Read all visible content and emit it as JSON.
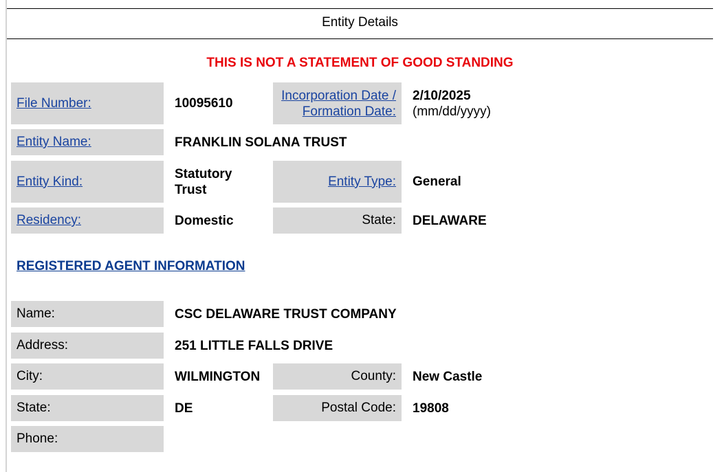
{
  "header": {
    "title": "Entity Details"
  },
  "warning": "THIS IS NOT A STATEMENT OF GOOD STANDING",
  "entity": {
    "file_number_label": "File Number:",
    "file_number": "10095610",
    "incorporation_label_1": "Incorporation Date /",
    "incorporation_label_2": "Formation Date:",
    "incorporation_date": "2/10/2025",
    "incorporation_format": "(mm/dd/yyyy)",
    "entity_name_label": "Entity Name:",
    "entity_name": "FRANKLIN SOLANA TRUST",
    "entity_kind_label": "Entity Kind:",
    "entity_kind_1": "Statutory",
    "entity_kind_2": "Trust",
    "entity_type_label": "Entity Type:",
    "entity_type": "General",
    "residency_label": "Residency:",
    "residency": "Domestic",
    "state_label": "State:",
    "state": "DELAWARE"
  },
  "agent": {
    "section_title": "REGISTERED AGENT INFORMATION",
    "name_label": "Name:",
    "name": "CSC DELAWARE TRUST COMPANY",
    "address_label": "Address:",
    "address": "251 LITTLE FALLS DRIVE",
    "city_label": "City:",
    "city": "WILMINGTON",
    "county_label": "County:",
    "county": "New Castle",
    "state_label": "State:",
    "state": "DE",
    "postal_label": "Postal Code:",
    "postal": "19808",
    "phone_label": "Phone:",
    "phone": ""
  }
}
